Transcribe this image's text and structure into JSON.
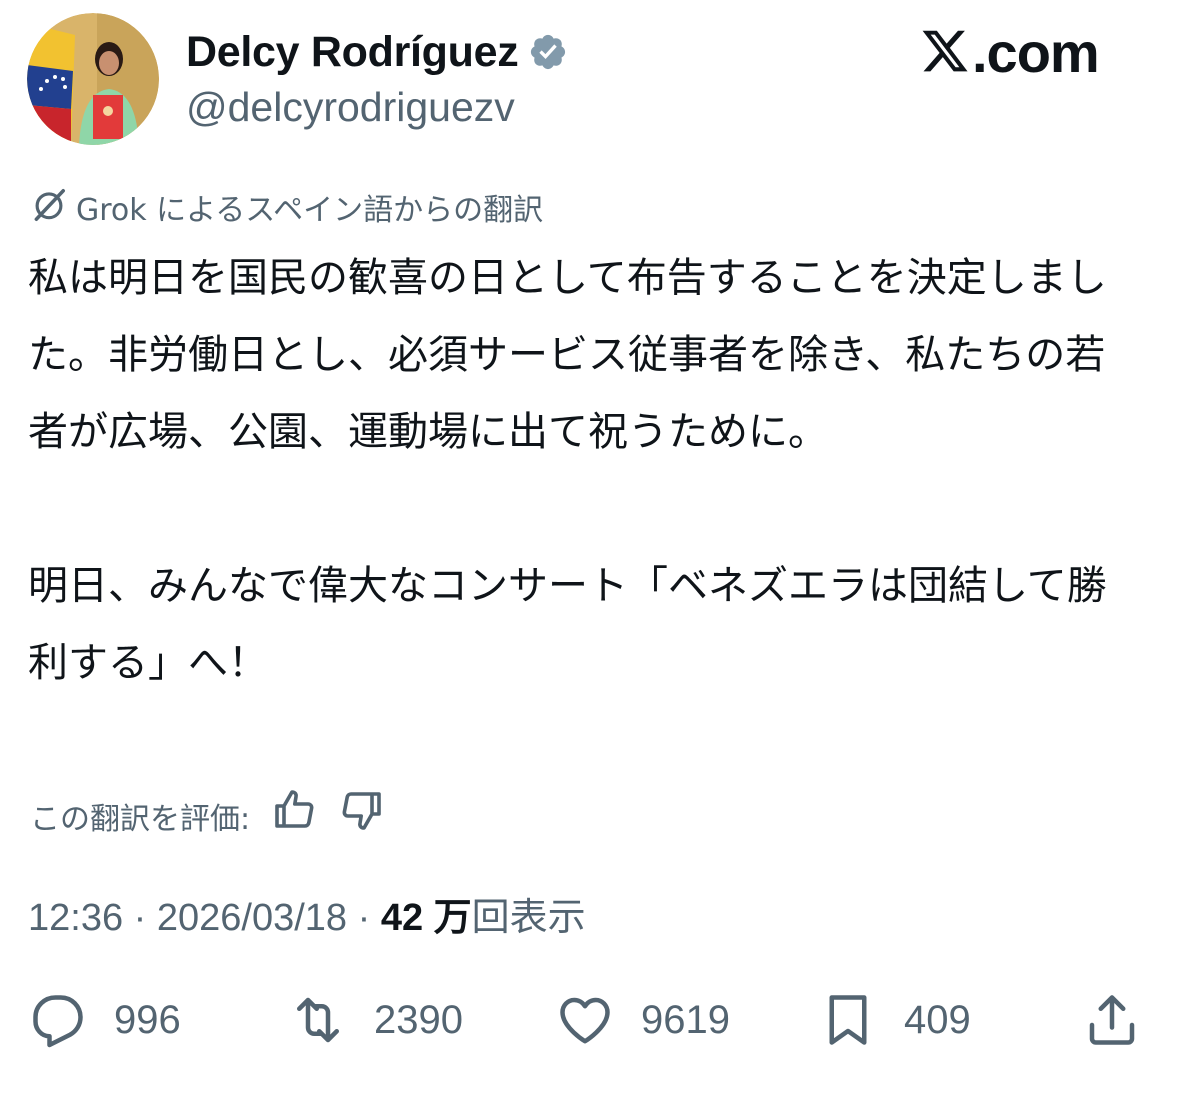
{
  "author": {
    "display_name": "Delcy Rodríguez",
    "handle": "@delcyrodriguezv",
    "verified_icon": "verified-badge-icon",
    "verified_color": "#829aab"
  },
  "site": {
    "label": ".com",
    "logo_icon": "x-logo-icon"
  },
  "translation": {
    "label": "Grok によるスペイン語からの翻訳",
    "icon": "grok-icon"
  },
  "post": {
    "paragraph_1": "私は明日を国民の歓喜の日として布告することを決定しました。非労働日とし、必須サービス従事者を除き、私たちの若者が広場、公園、運動場に出て祝うために。",
    "paragraph_2": "明日、みんなで偉大なコンサート「ベネズエラは団結して勝利する」へ！"
  },
  "rate": {
    "label": "この翻訳を評価:",
    "up_icon": "thumbs-up-icon",
    "down_icon": "thumbs-down-icon"
  },
  "meta": {
    "time": "12:36",
    "separator": " · ",
    "date": "2026/03/18",
    "views_count": "42 万",
    "views_label": "回表示"
  },
  "actions": {
    "replies": "996",
    "reposts": "2390",
    "likes": "9619",
    "bookmarks": "409"
  },
  "colors": {
    "text": "#0f1419",
    "secondary": "#536471"
  }
}
